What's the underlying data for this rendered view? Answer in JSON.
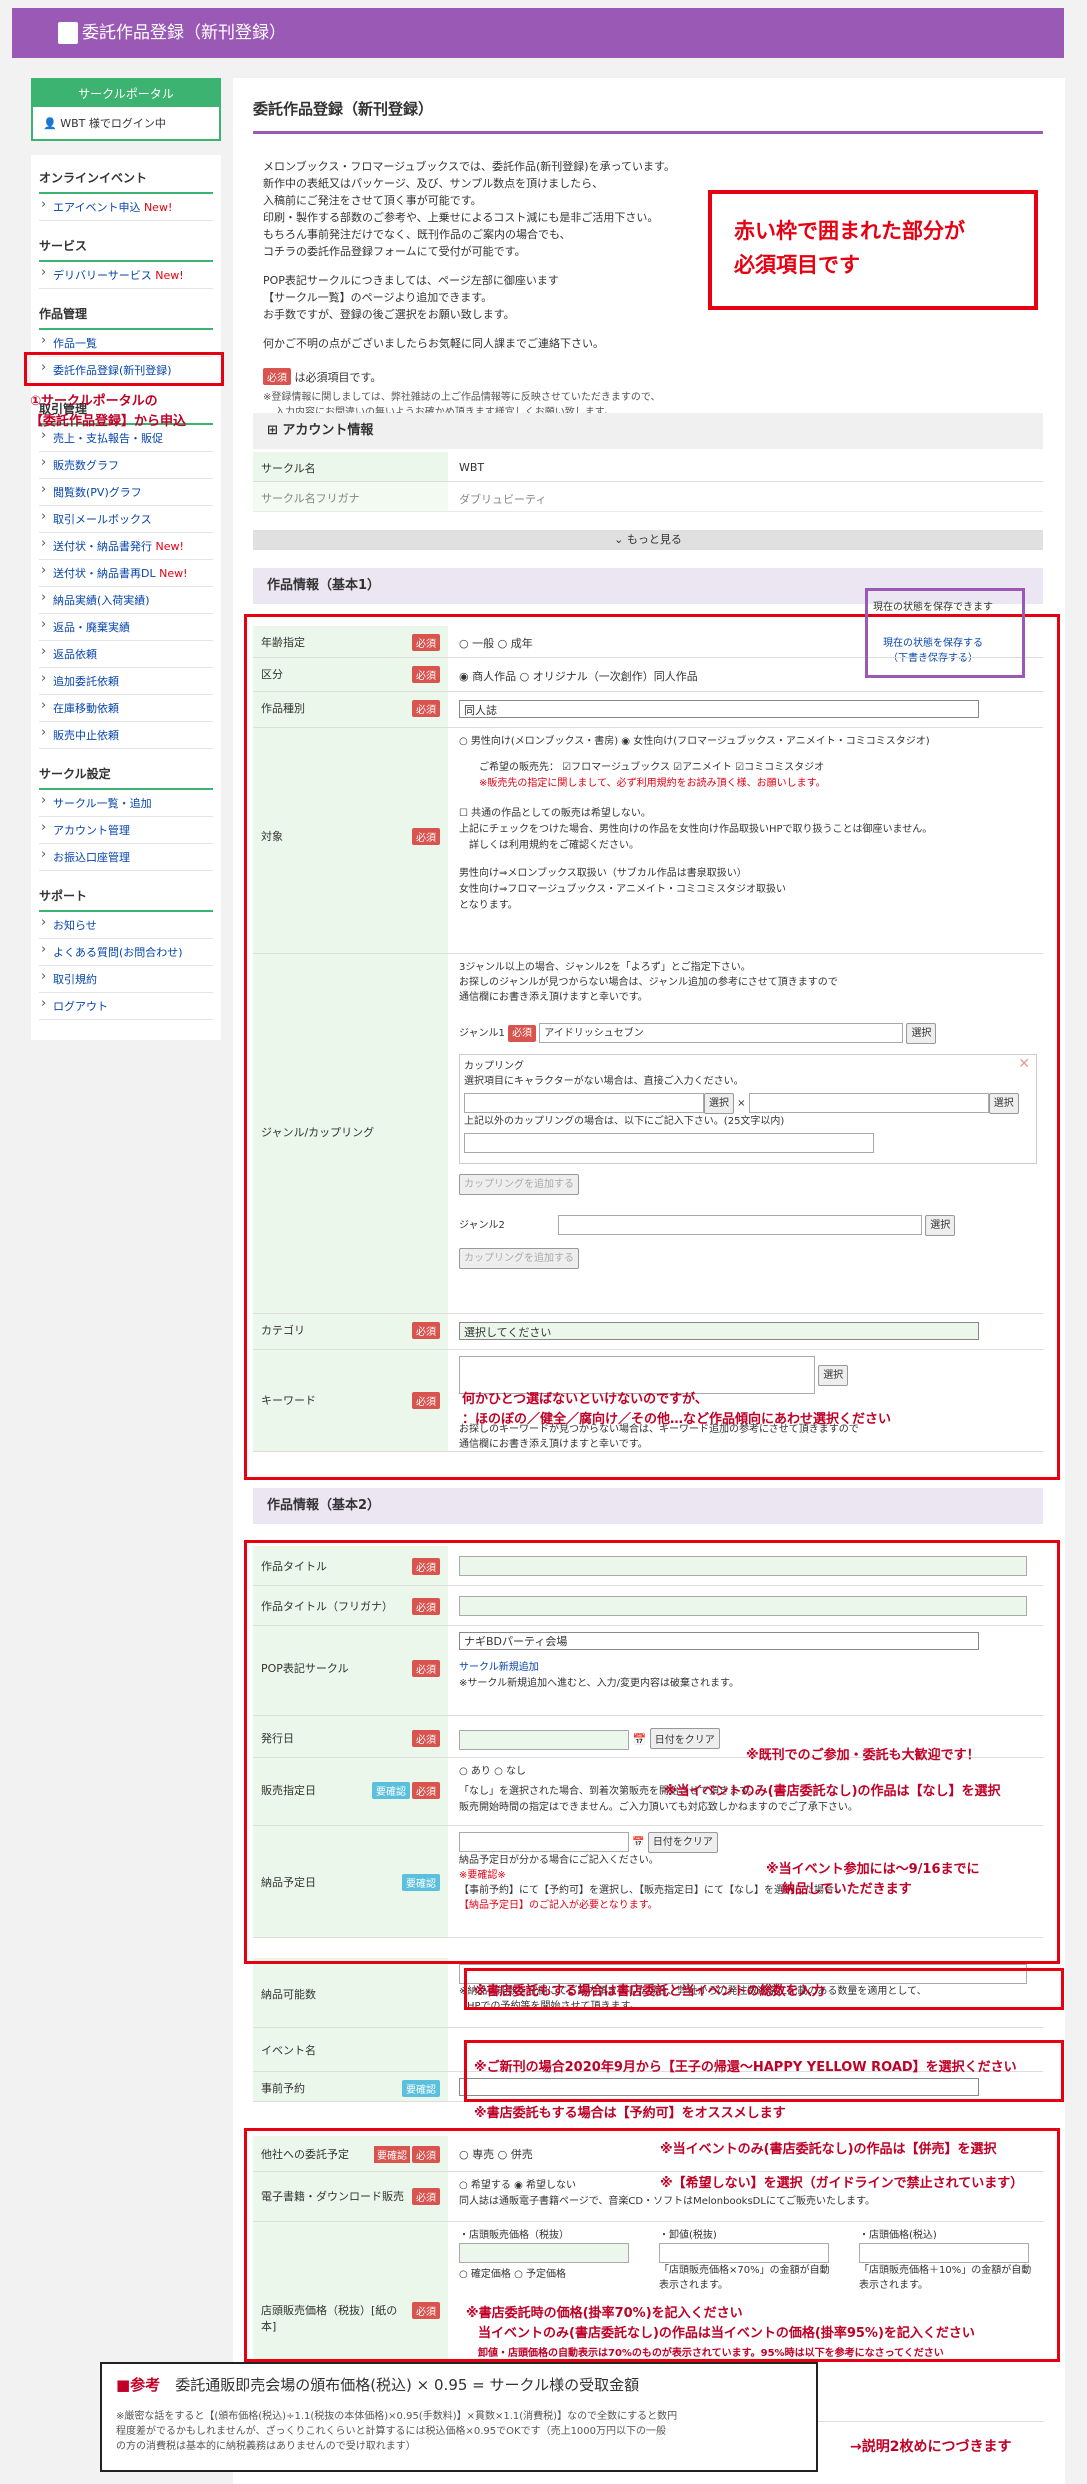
{
  "header": {
    "title": "委託作品登録（新刊登録）"
  },
  "sidebar": {
    "portal_title": "サークルポータル",
    "login": "WBT 様でログイン中",
    "sections": [
      {
        "title": "オンラインイベント",
        "items": [
          {
            "label": "エアイベント申込",
            "new": "New!"
          }
        ]
      },
      {
        "title": "サービス",
        "items": [
          {
            "label": "デリバリーサービス",
            "new": "New!"
          }
        ]
      },
      {
        "title": "作品管理",
        "items": [
          {
            "label": "作品一覧",
            "new": ""
          },
          {
            "label": "委託作品登録(新刊登録)",
            "new": ""
          }
        ]
      },
      {
        "title": "取引管理",
        "items": [
          {
            "label": "売上・支払報告・販促",
            "new": ""
          },
          {
            "label": "販売数グラフ",
            "new": ""
          },
          {
            "label": "閲覧数(PV)グラフ",
            "new": ""
          },
          {
            "label": "取引メールボックス",
            "new": ""
          },
          {
            "label": "送付状・納品書発行",
            "new": "New!"
          },
          {
            "label": "送付状・納品書再DL",
            "new": "New!"
          },
          {
            "label": "納品実績(入荷実績)",
            "new": ""
          },
          {
            "label": "返品・廃棄実績",
            "new": ""
          },
          {
            "label": "返品依頼",
            "new": ""
          },
          {
            "label": "追加委託依頼",
            "new": ""
          },
          {
            "label": "在庫移動依頼",
            "new": ""
          },
          {
            "label": "販売中止依頼",
            "new": ""
          }
        ]
      },
      {
        "title": "サークル設定",
        "items": [
          {
            "label": "サークル一覧・追加",
            "new": ""
          },
          {
            "label": "アカウント管理",
            "new": ""
          },
          {
            "label": "お振込口座管理",
            "new": ""
          }
        ]
      },
      {
        "title": "サポート",
        "items": [
          {
            "label": "お知らせ",
            "new": ""
          },
          {
            "label": "よくある質問(お問合わせ)",
            "new": ""
          },
          {
            "label": "取引規約",
            "new": ""
          },
          {
            "label": "ログアウト",
            "new": ""
          }
        ]
      }
    ],
    "annotation": [
      "①サークルポータルの",
      "【委託作品登録】から申込"
    ]
  },
  "main": {
    "title": "委託作品登録（新刊登録）",
    "intro": [
      "メロンブックス・フロマージュブックスでは、委託作品(新刊登録)を承っています。",
      "新作中の表紙又はパッケージ、及び、サンプル数点を頂けましたら、",
      "入稿前にご発注をさせて頂く事が可能です。",
      "印刷・製作する部数のご参考や、上乗せによるコスト減にも是非ご活用下さい。",
      "もちろん事前発注だけでなく、既刊作品のご案内の場合でも、",
      "コチラの委託作品登録フォームにて受付が可能です。",
      "",
      "POP表記サークルにつきましては、ページ左部に御座います",
      "【サークル一覧】のページより追加できます。",
      "お手数ですが、登録の後ご選択をお願い致します。",
      "",
      "何かご不明の点がございましたらお気軽に同人課までご連絡下さい。"
    ],
    "required_note": "は必須項目です。",
    "reg_note": [
      "※登録情報に関しましては、弊社雑誌の上ご作品情報等に反映させていただきますので、",
      "入力内容にお間違いの無いようお確かめ頂きます様宜しくお願い致します。"
    ],
    "notice": [
      "赤い枠で囲まれた部分が",
      "必須項目です"
    ],
    "account": {
      "title": "アカウント情報",
      "circle_label": "サークル名",
      "circle_value": "WBT",
      "kana_label": "サークル名フリガナ",
      "kana_value": "ダブリュビーティ",
      "more": "もっと見る"
    },
    "basic1": {
      "title": "作品情報（基本1）",
      "save_state": "現在の状態を保存できます",
      "save_btn": [
        "現在の状態を保存する",
        "（下書き保存する）"
      ],
      "age": {
        "label": "年齢指定",
        "opt1": "一般",
        "opt2": "成年"
      },
      "kubun": {
        "label": "区分",
        "opt1": "商人作品",
        "opt2": "オリジナル（一次創作）同人作品"
      },
      "type": {
        "label": "作品種別",
        "value": "同人誌"
      },
      "target": {
        "label": "対象",
        "line1": "男性向け(メロンブックス・書房)",
        "line2": "女性向け(フロマージュブックス・アニメイト・コミコミスタジオ)",
        "hope": "ご希望の販売先：",
        "c1": "フロマージュブックス",
        "c2": "アニメイト",
        "c3": "コミコミスタジオ",
        "warn": "※販売先の指定に関しまして、必ず利用規約をお読み頂く様、お願いします。",
        "common": "共通の作品としての販売は希望しない。",
        "check": "上記にチェックをつけた場合、男性向けの作品を女性向け作品取扱いHPで取り扱うことは御座いません。",
        "detail": "詳しくは利用規約をご確認ください。",
        "m1": "男性向け⇒メロンブックス取扱い（サブカル作品は書泉取扱い）",
        "m2": "女性向け⇒フロマージュブックス・アニメイト・コミコミスタジオ取扱い",
        "m3": "となります。"
      },
      "genre": {
        "label": "ジャンル/カップリング",
        "n1": "3ジャンル以上の場合、ジャンル2を「よろず」とご指定下さい。",
        "n2": "お探しのジャンルが見つからない場合は、ジャンル追加の参考にさせて頂きますので",
        "n3": "通信欄にお書き添え頂けますと幸いです。",
        "g1": "ジャンル1",
        "g1_value": "アイドリッシュセブン",
        "select": "選択",
        "cp": "カップリング",
        "cp_note": "選択項目にキャラクターがない場合は、直接ご入力ください。",
        "cp_other": "上記以外のカップリングの場合は、以下にご記入下さい。(25文字以内)",
        "cp_add": "カップリングを追加する",
        "g2": "ジャンル2"
      },
      "category": {
        "label": "カテゴリ",
        "value": "選択してください"
      },
      "keyword": {
        "label": "キーワード",
        "n1": "お探しのキーワードが見つからない場合は、キーワード追加の参考にさせて頂きますので",
        "n2": "通信欄にお書き添え頂けますと幸いです。",
        "ann1": "何かひとつ選ばないといけないのですが、",
        "ann2": "：ほのぼの／健全／腐向け／その他…など作品傾向にあわせ選択ください"
      }
    },
    "basic2": {
      "title": "作品情報（基本2）",
      "wtitle": "作品タイトル",
      "wkana": "作品タイトル（フリガナ）",
      "pop": {
        "label": "POP表記サークル",
        "value": "ナギBDパーティ会場",
        "link": "サークル新規追加",
        "note": "※サークル新規追加へ進むと、入力/変更内容は破棄されます。"
      },
      "issue": {
        "label": "発行日",
        "clear": "日付をクリア",
        "ann": "※既刊でのご参加・委託も大歓迎です！"
      },
      "sales": {
        "label": "販売指定日",
        "opt1": "あり",
        "opt2": "なし",
        "n1": "「なし」を選択された場合、到着次第販売を開始させて頂きます。",
        "n2": "販売開始時間の指定はできません。ご入力頂いても対応致しかねますのでご了承下さい。",
        "ann": "※当イベントのみ(書店委託なし)の作品は【なし】を選択"
      },
      "delivery": {
        "label": "納品予定日",
        "clear": "日付をクリア",
        "n1": "納品予定日が分かる場合にご記入ください。",
        "n2": "※要確認※",
        "n3": "【事前予約】にて【予約可】を選択し、【販売指定日】にて【なし】を選択した場合、",
        "n4": "【納品予定日】のご記入が必要となります。",
        "ann1": "※当イベント参加には～9/16までに",
        "ann2": "納品していただきます"
      },
      "qty": {
        "label": "納品可能数",
        "n1": "※納品可能数を空欄にてご案内頂きました場合、弊社からの発注数通常に記載のある数量を適用として、",
        "n2": "HPでの予約等を開始させて頂きます。",
        "ann": "※書店委託もする場合は書店委託と当イベントの総数を入力"
      },
      "event": {
        "label": "イベント名",
        "ann": "※ご新刊の場合2020年9月から【王子の帰還～HAPPY YELLOW ROAD】を選択ください"
      },
      "preorder": {
        "label": "事前予約",
        "ann": "※書店委託もする場合は【予約可】をオススメします"
      },
      "other": {
        "label": "他社への委託予定",
        "opt1": "専売",
        "opt2": "併売",
        "ann": "※当イベントのみ(書店委託なし)の作品は【併売】を選択"
      },
      "ebook": {
        "label": "電子書籍・ダウンロード販売",
        "opt1": "希望する",
        "opt2": "希望しない",
        "note": "同人誌は通販電子書籍ページで、音楽CD・ソフトはMelonbooksDLにてご販売いたします。",
        "ann": "※【希望しない】を選択（ガイドラインで禁止されています）"
      },
      "price": {
        "label": "店頭販売価格（税抜）[紙の本]",
        "h1": "・店頭販売価格（税抜）",
        "h2": "・卸値(税抜)",
        "h3": "・店頭価格(税込)",
        "fix": "確定価格",
        "plan": "予定価格",
        "n2": "「店頭販売価格×70%」の金額が自動表示されます。",
        "n3": "「店頭販売価格＋10%」の金額が自動表示されます。",
        "ann1": "※書店委託時の価格(掛率70%)を記入ください",
        "ann2": "当イベントのみ(書店委託なし)の作品は当イベントの価格(掛率95%)を記入ください",
        "ann3": "卸値・店頭価格の自動表示は70%のものが表示されています。95%時は以下を参考になさってください"
      }
    },
    "badges": {
      "req": "必須",
      "kak": "要確認",
      "kak2": "要確認"
    },
    "reference": {
      "label": "■参考",
      "formula": "委託通販即売会場の頒布価格(税込) × 0.95 = サークル様の受取金額",
      "n1": "※厳密な話をすると【(頒布価格(税込)÷1.1(税抜の本体価格)×0.95(手数料)】×貫数×1.1(消費税)】なので全数にすると数円",
      "n2": "程度差がでるかもしれませんが、ざっくりこれくらいと計算するには税込価格×0.95でOKです（売上1000万円以下の一般",
      "n3": "の方の消費税は基本的に納税義務はありませんので受け取れます）"
    },
    "continue": "→説明2枚めにつづきます"
  },
  "colors": {
    "purple": "#9b59b6",
    "green": "#3cb371",
    "red": "#e60012"
  }
}
